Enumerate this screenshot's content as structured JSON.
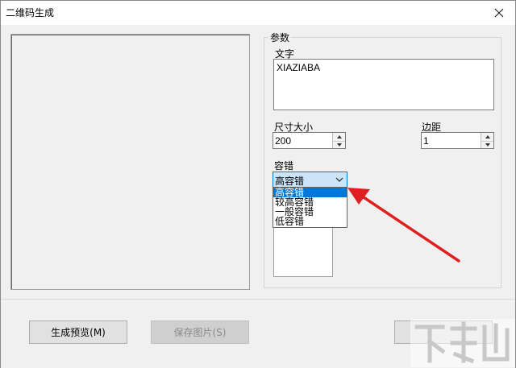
{
  "window": {
    "title": "二维码生成"
  },
  "params": {
    "group_label": "参数",
    "text_label": "文字",
    "text_value": "XIAZIABA",
    "size_label": "尺寸大小",
    "size_value": "200",
    "margin_label": "边距",
    "margin_value": "1",
    "ecc_label": "容错",
    "ecc_selected": "高容错",
    "ecc_options": [
      "高容错",
      "较高容错",
      "一般容错",
      "低容错"
    ]
  },
  "footer": {
    "preview_button": "生成预览(M)",
    "save_button": "保存图片(S)"
  },
  "colors": {
    "accent": "#0078d7",
    "arrow": "#e02020"
  }
}
